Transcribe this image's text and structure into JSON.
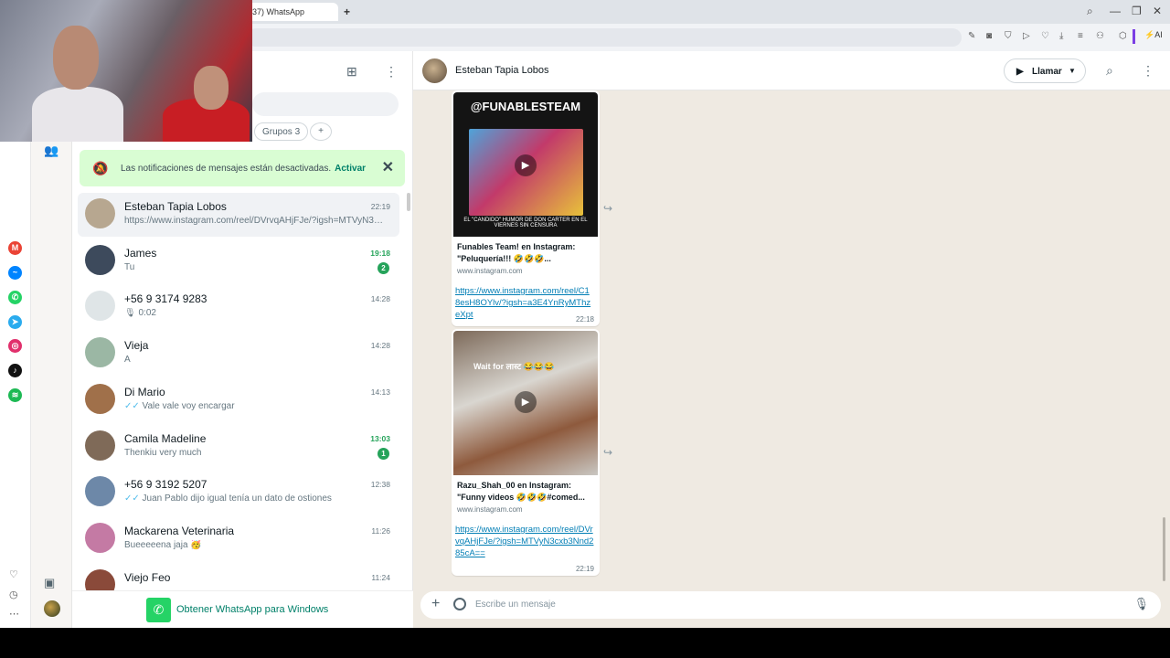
{
  "browser": {
    "tab_title": "37) WhatsApp",
    "new_tab": "+",
    "ai_label": "AI",
    "colors": {
      "tabbar": "#dfe3e8",
      "accent": "#7b3fe4"
    }
  },
  "rail": {
    "icons": [
      {
        "name": "gmail-icon",
        "glyph": "M",
        "color": "#ea4335"
      },
      {
        "name": "messenger-icon",
        "glyph": "~",
        "color": "#0084ff"
      },
      {
        "name": "whatsapp-icon",
        "glyph": "✆",
        "color": "#25d366"
      },
      {
        "name": "telegram-icon",
        "glyph": "➤",
        "color": "#2aabee"
      },
      {
        "name": "instagram-icon",
        "glyph": "◎",
        "color": "#e1306c"
      },
      {
        "name": "tiktok-icon",
        "glyph": "♪",
        "color": "#111111"
      },
      {
        "name": "spotify-icon",
        "glyph": "≋",
        "color": "#1db954"
      }
    ]
  },
  "chatlist": {
    "filter_chips": [
      {
        "label": "Grupos 3"
      },
      {
        "label": "+"
      }
    ],
    "notification": {
      "text": "Las notificaciones de mensajes están desactivadas.",
      "action": "Activar",
      "close": "✕"
    },
    "chats": [
      {
        "name": "Esteban Tapia Lobos",
        "preview": "https://www.instagram.com/reel/DVrvqAHjFJe/?igsh=MTVyN3cxb3Nnd285cA==",
        "time": "22:19",
        "unread": false,
        "badge": "",
        "ticks": "",
        "icon": "",
        "avatar": "#b7a790"
      },
      {
        "name": "James",
        "preview": "Tu",
        "time": "19:18",
        "unread": true,
        "badge": "2",
        "ticks": "",
        "icon": "",
        "avatar": "#3d4a5c"
      },
      {
        "name": "+56 9 3174 9283",
        "preview": "0:02",
        "time": "14:28",
        "unread": false,
        "badge": "",
        "ticks": "",
        "icon": "🎙",
        "avatar": "#dfe5e7"
      },
      {
        "name": "Vieja",
        "preview": "A",
        "time": "14:28",
        "unread": false,
        "badge": "",
        "ticks": "",
        "icon": "",
        "avatar": "#9bb7a4"
      },
      {
        "name": "Di Mario",
        "preview": "Vale vale voy encargar",
        "time": "14:13",
        "unread": false,
        "badge": "",
        "ticks": "✓✓",
        "icon": "",
        "avatar": "#a0704a"
      },
      {
        "name": "Camila Madeline",
        "preview": "Thenkiu very much",
        "time": "13:03",
        "unread": true,
        "badge": "1",
        "ticks": "",
        "icon": "",
        "avatar": "#7f6a58"
      },
      {
        "name": "+56 9 3192 5207",
        "preview": "Juan Pablo dijo igual tenía un dato de ostiones",
        "time": "12:38",
        "unread": false,
        "badge": "",
        "ticks": "✓✓",
        "icon": "",
        "avatar": "#6d88a8"
      },
      {
        "name": "Mackarena Veterinaria",
        "preview": "Bueeeeena jaja 🥳",
        "time": "11:26",
        "unread": false,
        "badge": "",
        "ticks": "",
        "icon": "",
        "avatar": "#c47aa4"
      },
      {
        "name": "Viejo Feo",
        "preview": "",
        "time": "11:24",
        "unread": false,
        "badge": "",
        "ticks": "",
        "icon": "",
        "avatar": "#8a4a3a"
      }
    ],
    "get_whatsapp": "Obtener WhatsApp para Windows"
  },
  "conversation": {
    "contact": "Esteban Tapia Lobos",
    "call_label": "Llamar",
    "messages": [
      {
        "thumb_brand": "@FUNABLESTEAM",
        "thumb_caption": "EL \"CANDIDO\" HUMOR DE DON CARTER EN EL VIERNES SIN CENSURA",
        "link_title": "Funables Team! en Instagram: \"Peluquería!!! 🤣🤣🤣...",
        "link_domain": "www.instagram.com",
        "url": "https://www.instagram.com/reel/C18esH8OYlv/?igsh=a3E4YnRyMThzeXpt",
        "time": "22:18"
      },
      {
        "thumb_caption": "Wait for लास्ट 😂😂😂",
        "link_title": "Razu_Shah_00 en Instagram: \"Funny videos 🤣🤣🤣#comed...",
        "link_domain": "www.instagram.com",
        "url": "https://www.instagram.com/reel/DVrvqAHjFJe/?igsh=MTVyN3cxb3Nnd285cA==",
        "time": "22:19"
      }
    ],
    "composer_placeholder": "Escribe un mensaje"
  }
}
